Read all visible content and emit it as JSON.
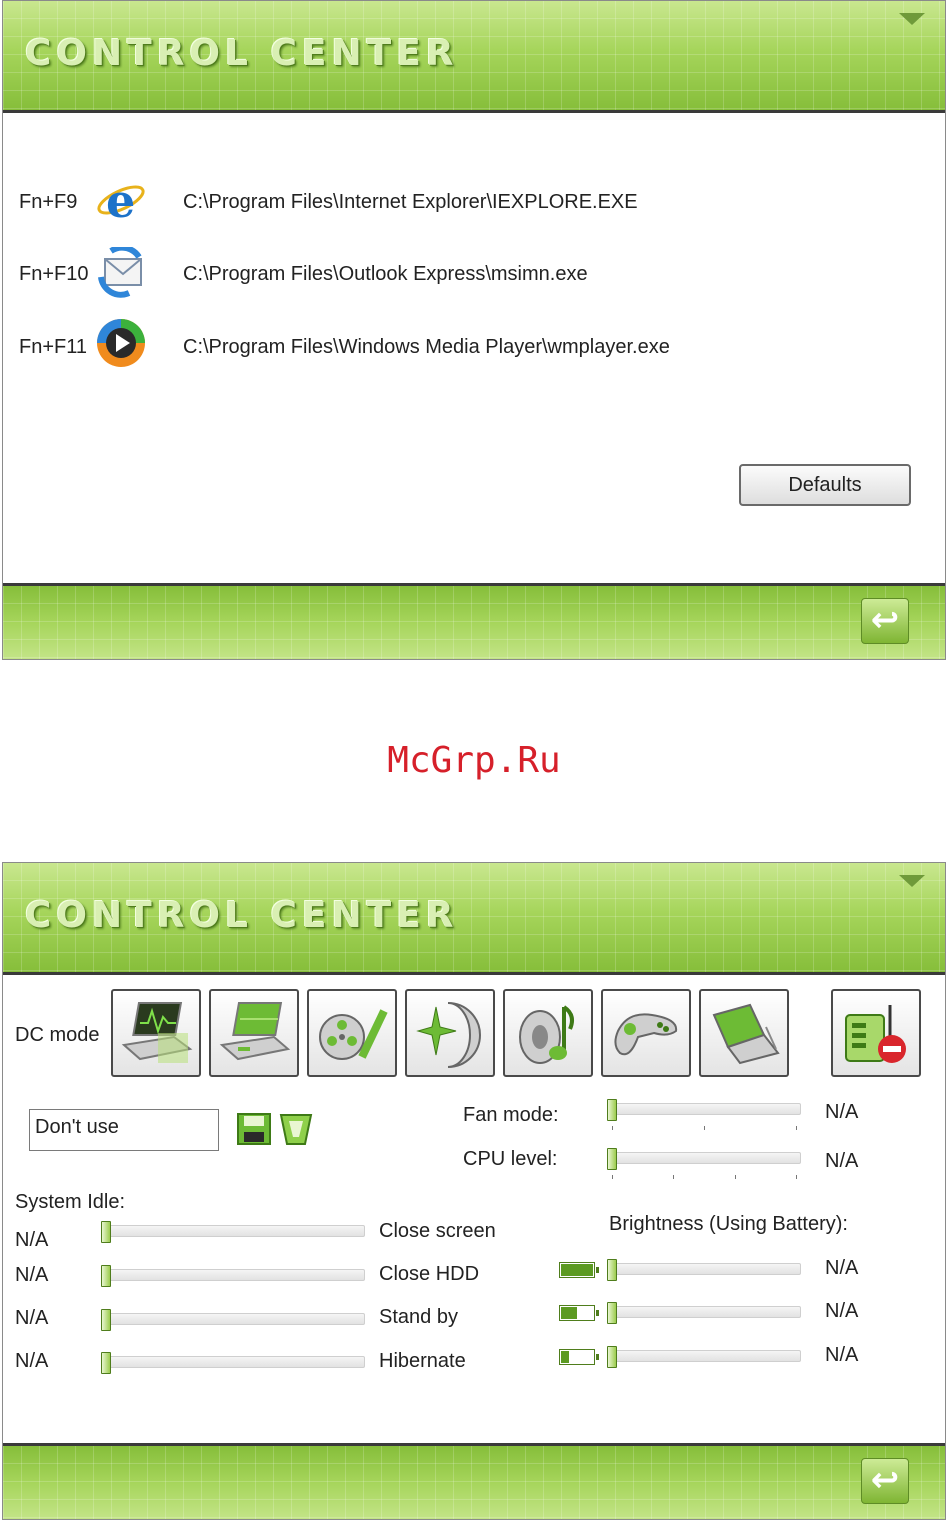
{
  "brand": {
    "title": "CONTROL CENTER",
    "accent": "#9ccc4e",
    "dark_line": "#3a3a3a"
  },
  "panel1": {
    "hotkeys": [
      {
        "key": "Fn+F9",
        "icon": "internet-explorer-icon",
        "path": "C:\\Program Files\\Internet Explorer\\IEXPLORE.EXE"
      },
      {
        "key": "Fn+F10",
        "icon": "outlook-express-icon",
        "path": "C:\\Program Files\\Outlook Express\\msimn.exe"
      },
      {
        "key": "Fn+F11",
        "icon": "windows-media-player-icon",
        "path": "C:\\Program Files\\Windows Media Player\\wmplayer.exe"
      }
    ],
    "defaults_label": "Defaults",
    "back_icon": "back-arrow-icon"
  },
  "watermark": "McGrp.Ru",
  "panel2": {
    "dc_mode_label": "DC mode",
    "mode_buttons": [
      {
        "icon": "laptop-performance-icon"
      },
      {
        "icon": "laptop-balanced-icon"
      },
      {
        "icon": "movie-film-icon"
      },
      {
        "icon": "presentation-star-icon"
      },
      {
        "icon": "music-note-icon"
      },
      {
        "icon": "gamepad-icon"
      },
      {
        "icon": "laptop-power-saving-icon"
      }
    ],
    "remove_mode_icon": "remove-profile-icon",
    "profile_value": "Don't use",
    "save_icon": "floppy-disk-icon",
    "delete_icon": "trash-bin-icon",
    "fan_mode": {
      "label": "Fan mode:",
      "value": "N/A"
    },
    "cpu_level": {
      "label": "CPU level:",
      "value": "N/A"
    },
    "system_idle": {
      "label": "System Idle:",
      "rows": [
        {
          "value": "N/A",
          "label": "Close screen"
        },
        {
          "value": "N/A",
          "label": "Close HDD"
        },
        {
          "value": "N/A",
          "label": "Stand by"
        },
        {
          "value": "N/A",
          "label": "Hibernate"
        }
      ]
    },
    "brightness": {
      "label": "Brightness (Using Battery):",
      "rows": [
        {
          "battery_level": 1.0,
          "value": "N/A"
        },
        {
          "battery_level": 0.5,
          "value": "N/A"
        },
        {
          "battery_level": 0.25,
          "value": "N/A"
        }
      ]
    },
    "back_icon": "back-arrow-icon"
  }
}
